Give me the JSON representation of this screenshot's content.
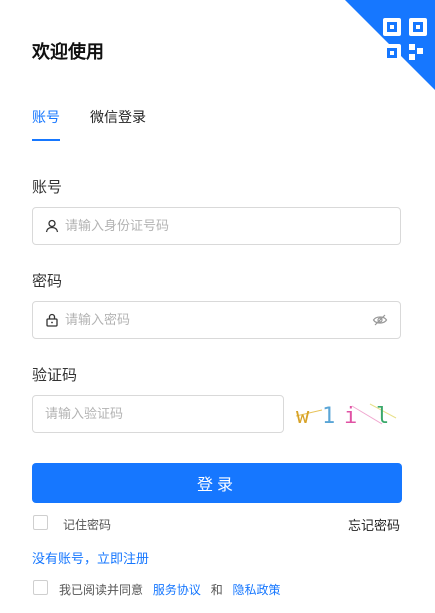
{
  "header": {
    "title": "欢迎使用"
  },
  "tabs": [
    {
      "label": "账号",
      "active": true
    },
    {
      "label": "微信登录",
      "active": false
    }
  ],
  "account": {
    "label": "账号",
    "placeholder": "请输入身份证号码",
    "value": ""
  },
  "password": {
    "label": "密码",
    "placeholder": "请输入密码",
    "value": ""
  },
  "captcha": {
    "label": "验证码",
    "placeholder": "请输入验证码",
    "value": "",
    "image_text": "w1i l"
  },
  "login_button": "登录",
  "remember": {
    "label": "记住密码",
    "checked": false
  },
  "forgot_password": "忘记密码",
  "register_link": "没有账号，立即注册",
  "agreement": {
    "prefix": "我已阅读并同意",
    "service": "服务协议",
    "and": "和",
    "privacy": "隐私政策",
    "checked": false
  },
  "colors": {
    "accent": "#1677ff"
  },
  "icons": [
    "qrcode-icon",
    "user-icon",
    "lock-icon",
    "eye-off-icon"
  ]
}
